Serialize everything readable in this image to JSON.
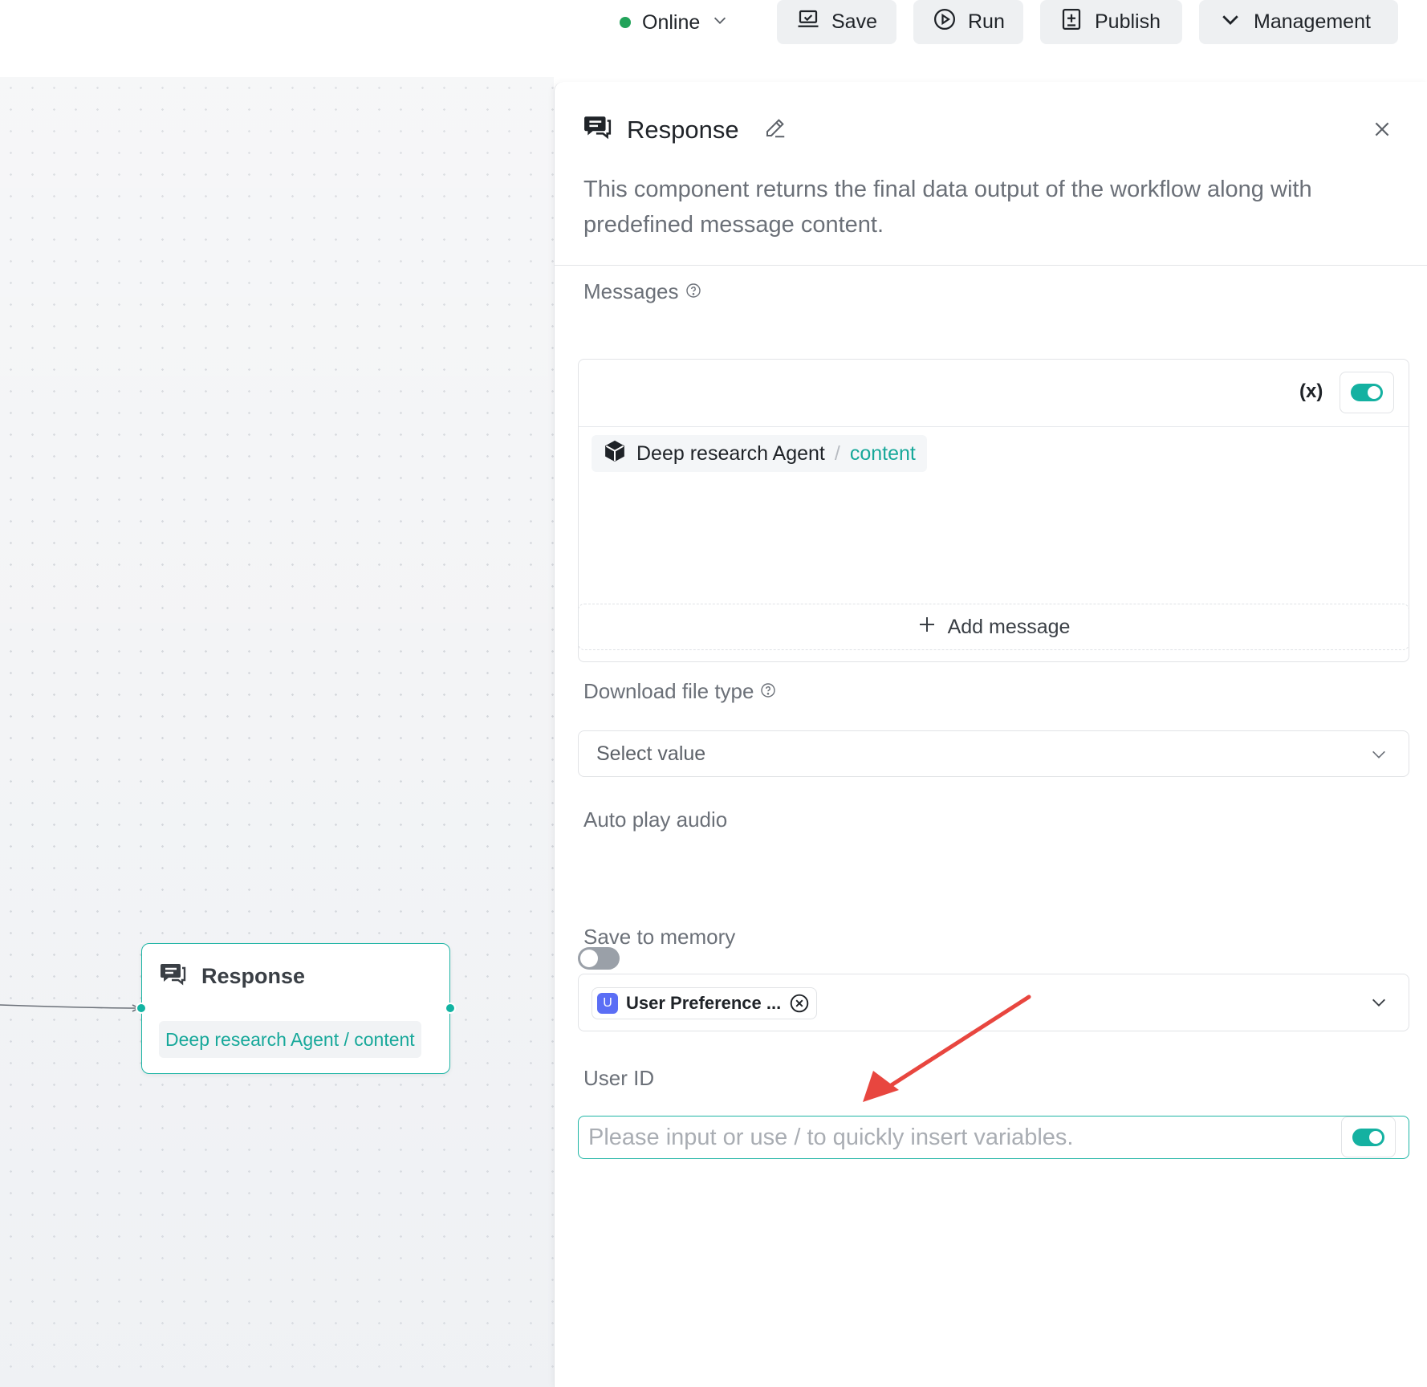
{
  "toolbar": {
    "status_label": "Online",
    "save_label": "Save",
    "run_label": "Run",
    "publish_label": "Publish",
    "management_label": "Management"
  },
  "canvas": {
    "node": {
      "title": "Response",
      "reference": "Deep research Agent / content"
    }
  },
  "panel": {
    "title": "Response",
    "description": "This component returns the final data output of the workflow along with predefined message content.",
    "messages": {
      "label": "Messages",
      "var_icon": "(x)",
      "reference": {
        "agent": "Deep research Agent",
        "separator": "/",
        "field": "content"
      },
      "add_message_label": "Add message"
    },
    "download_file_type": {
      "label": "Download file type",
      "placeholder": "Select value"
    },
    "auto_play_audio": {
      "label": "Auto play audio",
      "enabled": false
    },
    "save_to_memory": {
      "label": "Save to memory",
      "badge": "U",
      "selected": "User Preference ..."
    },
    "user_id": {
      "label": "User ID",
      "placeholder": "Please input or use / to quickly insert variables."
    }
  },
  "colors": {
    "accent": "#14b1a1",
    "online": "#22a35a",
    "annotation_arrow": "#e8463f",
    "memory_badge": "#5b6ef5"
  }
}
